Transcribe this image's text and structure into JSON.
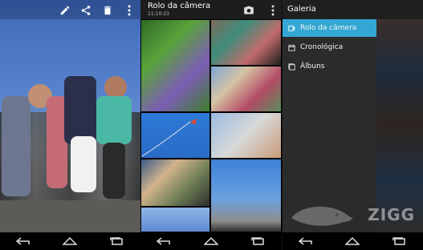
{
  "panel1": {
    "toolbar": {
      "icons": [
        "edit-icon",
        "share-icon",
        "delete-icon",
        "overflow-menu-icon"
      ]
    }
  },
  "panel2": {
    "title": "Rolo da câmera",
    "subtitle": "11:10:23",
    "toolbar": {
      "icons": [
        "camera-icon",
        "overflow-menu-icon"
      ]
    }
  },
  "panel3": {
    "title": "Galeria",
    "drawer": {
      "items": [
        {
          "label": "Rolo da câmera",
          "icon": "camera-roll-icon",
          "selected": true
        },
        {
          "label": "Cronológica",
          "icon": "calendar-icon",
          "selected": false
        },
        {
          "label": "Álbuns",
          "icon": "albums-icon",
          "selected": false
        }
      ]
    },
    "watermark": "ZIGG"
  },
  "colors": {
    "accent": "#35a7d4",
    "drawer_bg": "#2b2b2b",
    "toolbar_bg": "#1d1d1d"
  }
}
